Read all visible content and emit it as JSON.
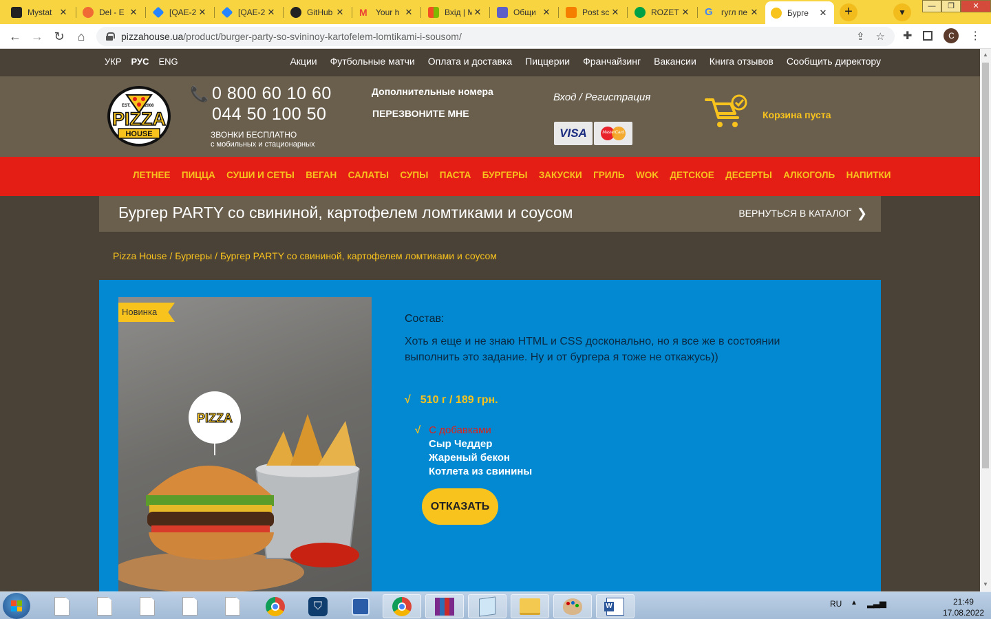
{
  "browser": {
    "tabs": [
      {
        "label": "Mystat",
        "favicon_color": "#222222"
      },
      {
        "label": "Del - E",
        "favicon_color": "#f06a35"
      },
      {
        "label": "[QAE-2",
        "favicon_color": "#2684ff"
      },
      {
        "label": "[QAE-2",
        "favicon_color": "#2684ff"
      },
      {
        "label": "GitHub",
        "favicon_color": "#222222"
      },
      {
        "label": "Your h",
        "favicon_color": "#ea4335"
      },
      {
        "label": "Вхід | M",
        "favicon_color": "#00a4ef"
      },
      {
        "label": "Общи",
        "favicon_color": "#5b5fc7"
      },
      {
        "label": "Post sc",
        "favicon_color": "#f57d00"
      },
      {
        "label": "ROZET",
        "favicon_color": "#00a046"
      },
      {
        "label": "гугл пе",
        "favicon_color": "#4285f4"
      },
      {
        "label": "Бурге",
        "favicon_color": "#f8c31d",
        "active": true
      }
    ],
    "close_glyph": "✕",
    "new_tab_glyph": "+",
    "url_host": "pizzahouse.ua",
    "url_path": "/product/burger-party-so-svininoy-kartofelem-lomtikami-i-sousom/",
    "profile_initial": "C"
  },
  "site": {
    "languages": [
      "УКР",
      "РУС",
      "ENG"
    ],
    "top_nav": [
      "Акции",
      "Футбольные матчи",
      "Оплата и доставка",
      "Пиццерии",
      "Франчайзинг",
      "Вакансии",
      "Книга отзывов",
      "Сообщить директору"
    ],
    "logo": {
      "est": "EST.",
      "year": "2008",
      "word1": "PIZZA",
      "word2": "HOUSE"
    },
    "phone1": "0 800 60 10 60",
    "phone2": "044 50 100 50",
    "free_call_line1": "ЗВОНКИ БЕСПЛАТНО",
    "free_call_line2": "с мобильных и стационарных",
    "extra_numbers": "Дополнительные номера",
    "callback": "ПЕРЕЗВОНИТЕ МНЕ",
    "login": "Вход / Регистрация",
    "visa": "VISA",
    "mastercard": "MasterCard",
    "cart_text": "Корзина пуста",
    "categories": [
      "ЛЕТНЕЕ",
      "ПИЦЦА",
      "СУШИ И СЕТЫ",
      "ВЕГАН",
      "САЛАТЫ",
      "СУПЫ",
      "ПАСТА",
      "БУРГЕРЫ",
      "ЗАКУСКИ",
      "ГРИЛЬ",
      "WOK",
      "ДЕТСКОЕ",
      "ДЕСЕРТЫ",
      "АЛКОГОЛЬ",
      "НАПИТКИ"
    ],
    "product_title": "Бургер PARTY со свининой, картофелем ломтиками и соусом",
    "back_to_catalog": "ВЕРНУТЬСЯ В КАТАЛОГ",
    "breadcrumb": [
      "Pizza House",
      "Бургеры",
      "Бургер PARTY со свининой, картофелем ломтиками и соусом"
    ],
    "badge": "Новинка",
    "composition_label": "Состав:",
    "composition_text": "Хоть я еще и не знаю HTML и CSS досконально, но я все же в состоянии выполнить это задание. Ну и от бургера я тоже не откажусь))",
    "tick": "√",
    "price": "510 г / 189 грн.",
    "addons_header": "С добавками",
    "addons": [
      "Сыр Чеддер",
      "Жареный бекон",
      "Котлета из свинины"
    ],
    "refuse_button": "ОТКАЗАТЬ",
    "colors": {
      "brown_dark": "#4a4137",
      "brown": "#6a5f4d",
      "red": "#e41e14",
      "yellow": "#f8c31d",
      "blue": "#0289d2"
    }
  },
  "taskbar": {
    "language": "RU",
    "time": "21:49",
    "date": "17.08.2022",
    "apps": [
      "document-icon",
      "document-icon",
      "document-icon",
      "document-icon",
      "document-icon",
      "chrome-icon",
      "vpn-shield-icon",
      "remote-desktop-icon",
      "chrome-profile-icon",
      "winrar-icon",
      "notepad-icon",
      "folder-icon",
      "paint-icon",
      "word-icon"
    ]
  }
}
